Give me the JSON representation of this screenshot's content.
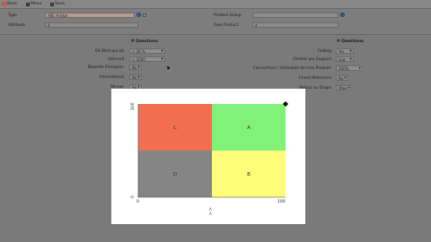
{
  "toolbar": {
    "back_label": "Back",
    "menu_label": "Menu",
    "save_label": "Save"
  },
  "header": {
    "type_label": "Type",
    "type_value": "ABC-Artikel",
    "attribute_label": "Attribute",
    "attribute_value": "4",
    "product_group_label": "Product Group",
    "product_group_value": "",
    "own_product_label": "Own Product",
    "own_product_value": "4"
  },
  "left_section": {
    "title": "# Questions",
    "rows": [
      {
        "label": "EK Wert pro Ist",
        "value": "> 30 %"
      },
      {
        "label": "Intervall",
        "value": "< 1000"
      },
      {
        "label": "Bewerte Prinzipien",
        "value": "No"
      },
      {
        "label": "International",
        "value": "No"
      },
      {
        "label": "Winner",
        "value": "No"
      }
    ]
  },
  "right_section": {
    "title": "# Questions",
    "rows": [
      {
        "label": "Folding",
        "value": "Yes"
      },
      {
        "label": "Fenster pro Support",
        "value": "Low"
      },
      {
        "label": "Courverture / Utilisation de mes Produits",
        "value": "100%"
      },
      {
        "label": "Check Reference",
        "value": "No"
      },
      {
        "label": "Retour au Drape",
        "value": "Wwe"
      }
    ]
  },
  "chart_data": {
    "type": "heatmap",
    "xlim": [
      0,
      100
    ],
    "ylim": [
      0,
      100
    ],
    "x_ticks": [
      "0",
      "100"
    ],
    "y_ticks": [
      "0",
      "100"
    ],
    "quadrants": [
      {
        "label": "C",
        "position": "top-left",
        "color": "#f26e4f"
      },
      {
        "label": "A",
        "position": "top-right",
        "color": "#80f27a"
      },
      {
        "label": "D",
        "position": "bottom-left",
        "color": "#858585"
      },
      {
        "label": "B",
        "position": "bottom-right",
        "color": "#fdfd7a"
      }
    ],
    "marker": {
      "x": 100,
      "y": 100,
      "shape": "diamond",
      "color": "#000000"
    },
    "axis_markers": [
      "A",
      "A"
    ],
    "grid": false
  }
}
